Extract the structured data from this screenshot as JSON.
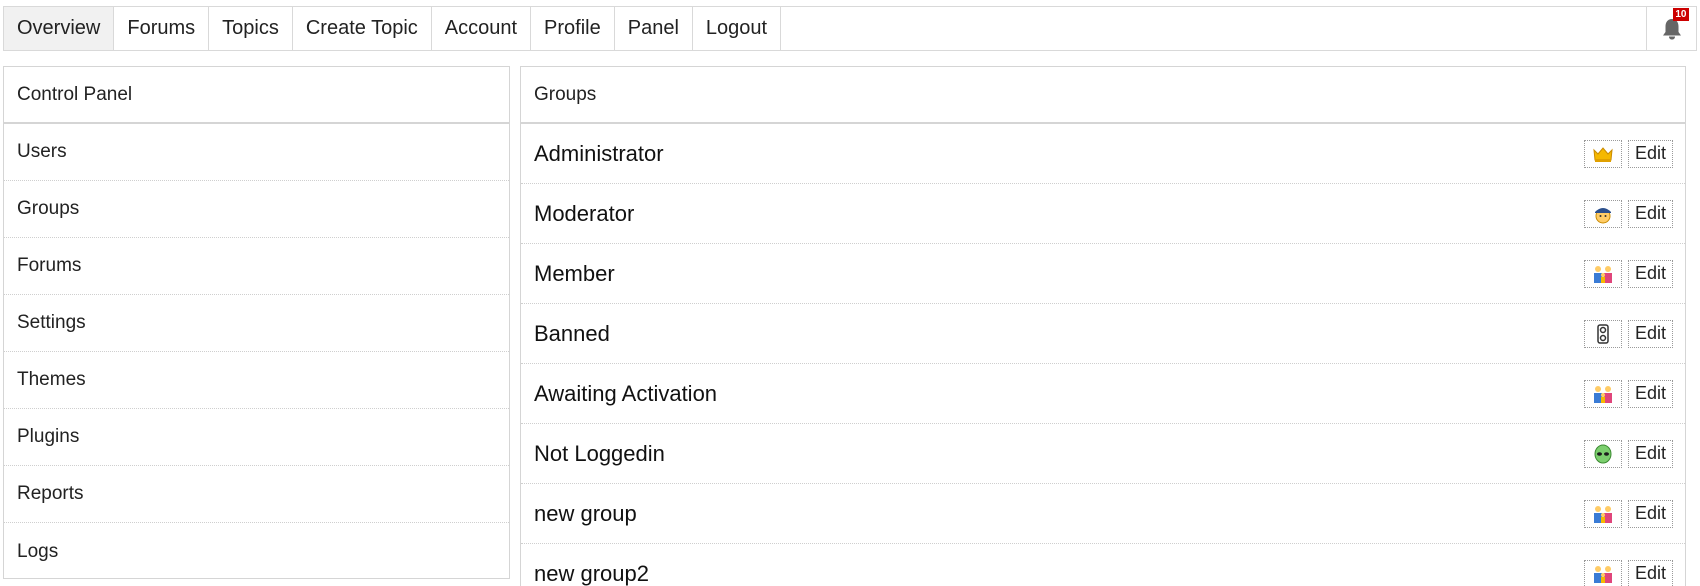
{
  "nav": {
    "items": [
      {
        "id": "overview",
        "label": "Overview",
        "active": true
      },
      {
        "id": "forums",
        "label": "Forums"
      },
      {
        "id": "topics",
        "label": "Topics"
      },
      {
        "id": "create-topic",
        "label": "Create Topic"
      },
      {
        "id": "account",
        "label": "Account"
      },
      {
        "id": "profile",
        "label": "Profile"
      },
      {
        "id": "panel",
        "label": "Panel"
      },
      {
        "id": "logout",
        "label": "Logout"
      }
    ],
    "alerts": {
      "count": "10",
      "icon": "bell-icon",
      "badge_color": "#cc0000"
    }
  },
  "control_panel": {
    "title": "Control Panel",
    "items": [
      "Users",
      "Groups",
      "Forums",
      "Settings",
      "Themes",
      "Plugins",
      "Reports",
      "Logs"
    ]
  },
  "groups_panel": {
    "title": "Groups",
    "edit_label": "Edit",
    "groups": [
      {
        "name": "Administrator",
        "tag_icon": "crown-icon"
      },
      {
        "name": "Moderator",
        "tag_icon": "police-officer-icon"
      },
      {
        "name": "Member",
        "tag_icon": "family-icon"
      },
      {
        "name": "Banned",
        "tag_icon": "shackles-icon"
      },
      {
        "name": "Awaiting Activation",
        "tag_icon": "family-icon"
      },
      {
        "name": "Not Loggedin",
        "tag_icon": "alien-icon"
      },
      {
        "name": "new group",
        "tag_icon": "family-icon"
      },
      {
        "name": "new group2",
        "tag_icon": "family-icon"
      }
    ]
  }
}
